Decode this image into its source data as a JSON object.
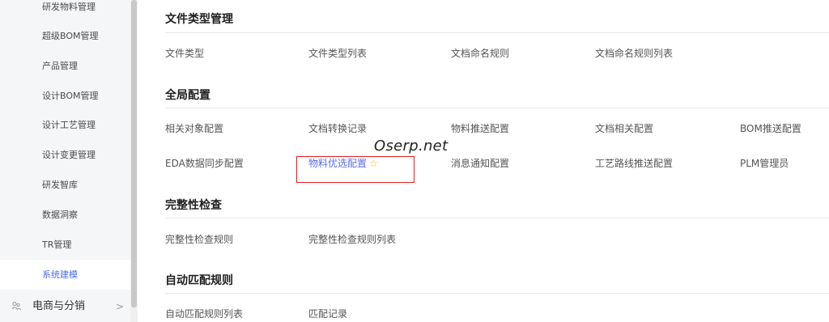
{
  "sidebar": {
    "items": [
      {
        "label": "研发物料管理"
      },
      {
        "label": "超级BOM管理"
      },
      {
        "label": "产品管理"
      },
      {
        "label": "设计BOM管理"
      },
      {
        "label": "设计工艺管理"
      },
      {
        "label": "设计变更管理"
      },
      {
        "label": "研发智库"
      },
      {
        "label": "数据洞察"
      },
      {
        "label": "TR管理"
      },
      {
        "label": "系统建模",
        "active": true
      }
    ],
    "group": {
      "label": "电商与分销",
      "icon": "people-icon",
      "chevron": ">"
    }
  },
  "sections": [
    {
      "title": "文件类型管理",
      "links": [
        "文件类型",
        "文件类型列表",
        "文档命名规则",
        "文档命名规则列表"
      ]
    },
    {
      "title": "全局配置",
      "row1": [
        "相关对象配置",
        "文档转换记录",
        "物料推送配置",
        "文档相关配置",
        "BOM推送配置"
      ],
      "row2": [
        "EDA数据同步配置",
        "物料优选配置",
        "消息通知配置",
        "工艺路线推送配置",
        "PLM管理员"
      ]
    },
    {
      "title": "完整性检查",
      "links": [
        "完整性检查规则",
        "完整性检查规则列表"
      ]
    },
    {
      "title": "自动匹配规则",
      "links": [
        "自动匹配规则列表",
        "匹配记录"
      ]
    }
  ],
  "favorite_icon": "star-outline-icon",
  "watermark": "Oserp.net",
  "colors": {
    "accent": "#5b6cf0",
    "highlight_border": "#e02020",
    "star": "#f5b400",
    "sidebar_bg": "#f5f6f8"
  }
}
